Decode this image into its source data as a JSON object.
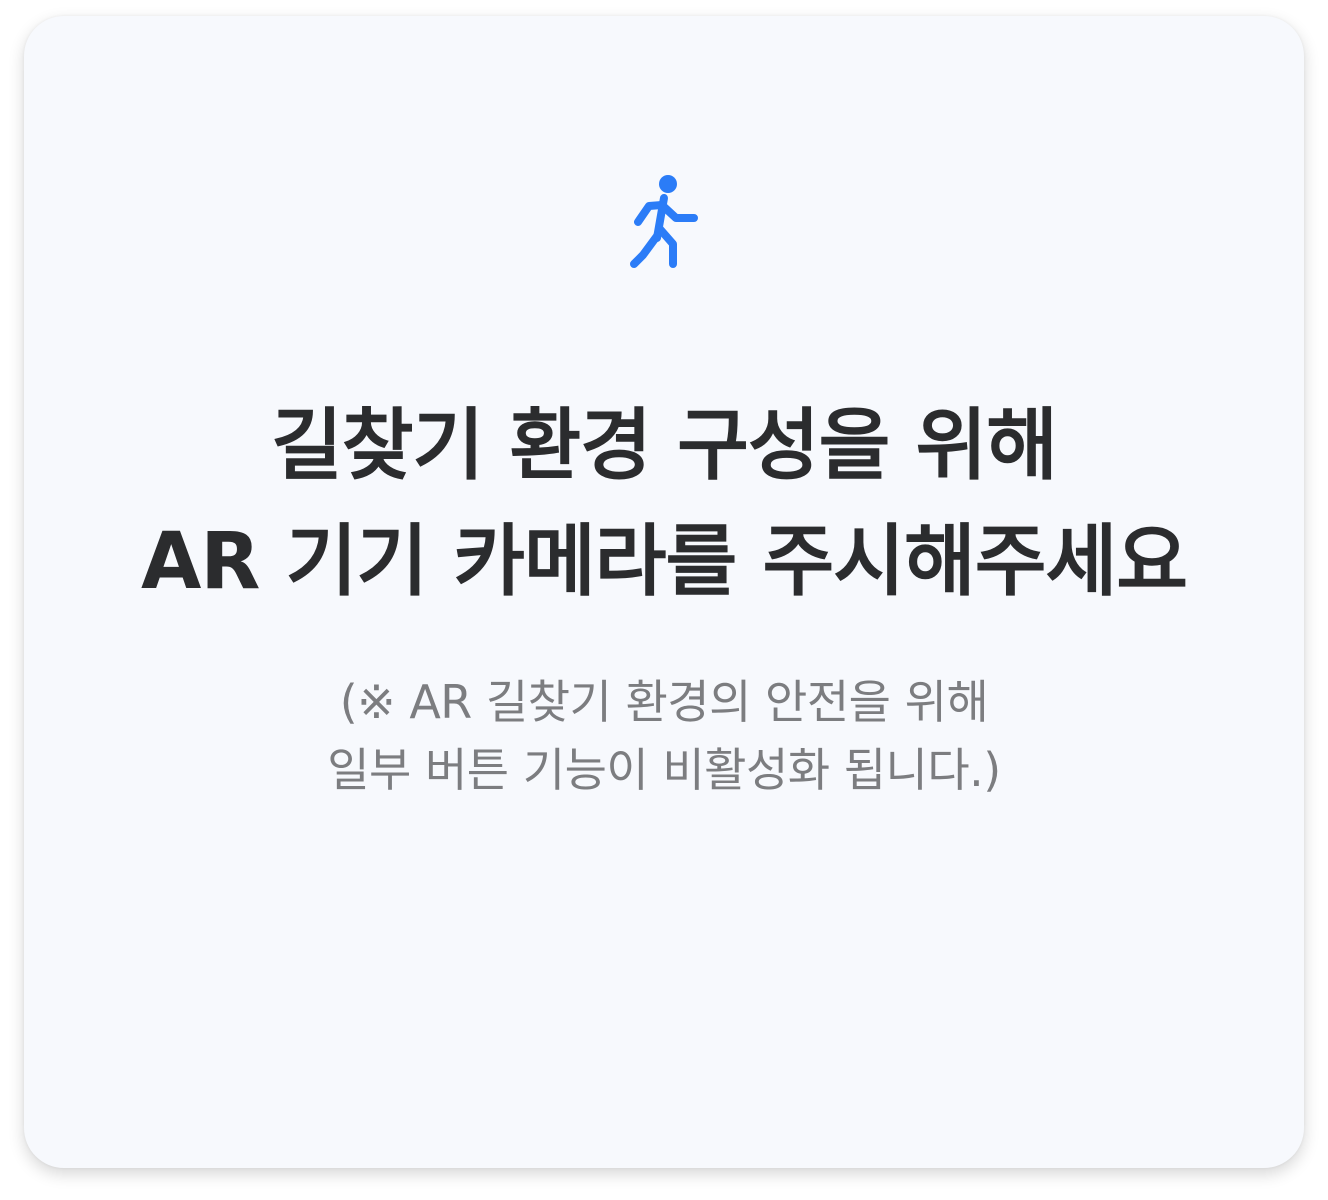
{
  "dialog": {
    "icon": "walking-person-icon",
    "accent_color": "#2b7cf7",
    "title_line1": "길찾기 환경 구성을 위해",
    "title_line2": "AR 기기 카메라를 주시해주세요",
    "notice_line1": "(※ AR 길찾기 환경의 안전을 위해",
    "notice_line2": "일부 버튼 기능이 비활성화 됩니다.)"
  }
}
